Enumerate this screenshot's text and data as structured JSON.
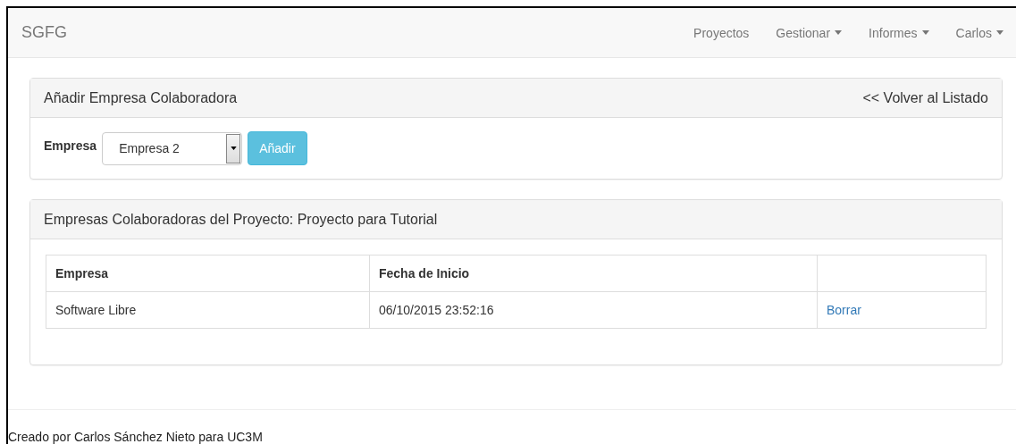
{
  "navbar": {
    "brand": "SGFG",
    "items": [
      {
        "label": "Proyectos",
        "dropdown": false
      },
      {
        "label": "Gestionar",
        "dropdown": true
      },
      {
        "label": "Informes",
        "dropdown": true
      },
      {
        "label": "Carlos",
        "dropdown": true
      }
    ]
  },
  "add_panel": {
    "title": "Añadir Empresa Colaboradora",
    "back_link": "<< Volver al Listado",
    "field_label": "Empresa",
    "select_value": "Empresa 2",
    "button": "Añadir"
  },
  "list_panel": {
    "title": "Empresas Colaboradoras del Proyecto: Proyecto para Tutorial",
    "table": {
      "columns": [
        "Empresa",
        "Fecha de Inicio"
      ],
      "rows": [
        {
          "cells": [
            "Software Libre",
            "06/10/2015 23:52:16"
          ],
          "action": "Borrar"
        }
      ]
    }
  },
  "footer": "Creado por Carlos Sánchez Nieto para UC3M"
}
